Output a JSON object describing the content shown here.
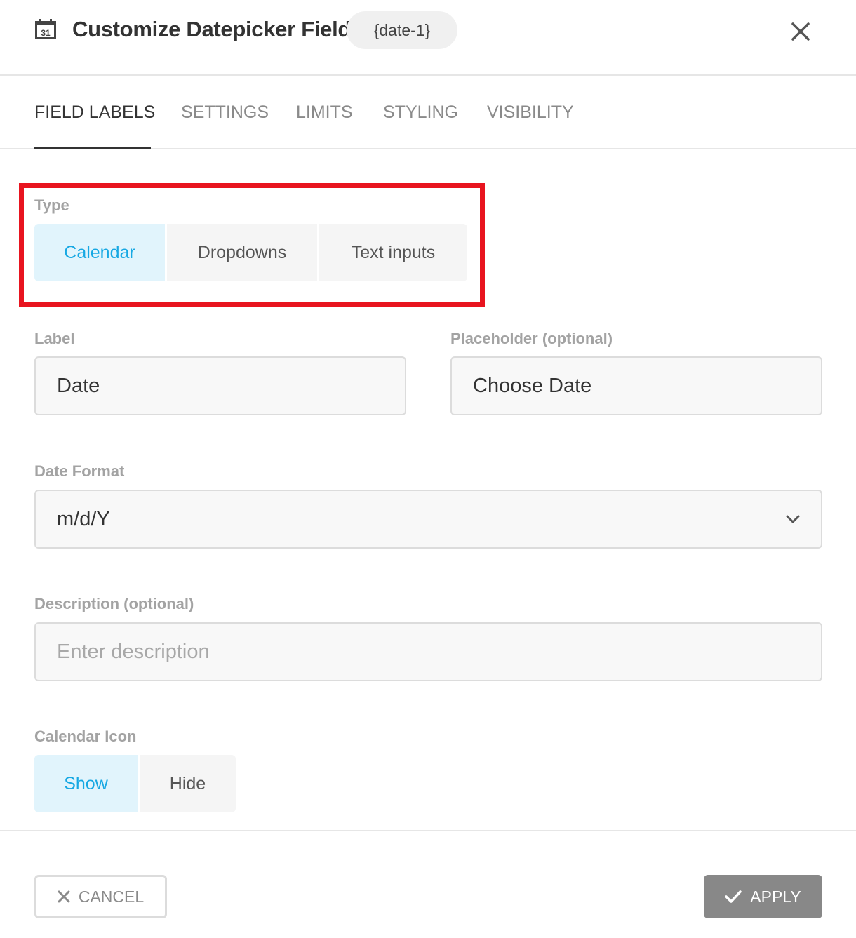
{
  "header": {
    "icon": "calendar-31-icon",
    "icon_day": "31",
    "title": "Customize Datepicker Field",
    "tag": "{date-1}",
    "close_icon": "close-icon"
  },
  "tabs": [
    {
      "label": "FIELD LABELS",
      "active": true
    },
    {
      "label": "SETTINGS",
      "active": false
    },
    {
      "label": "LIMITS",
      "active": false
    },
    {
      "label": "STYLING",
      "active": false
    },
    {
      "label": "VISIBILITY",
      "active": false
    }
  ],
  "type": {
    "label": "Type",
    "options": [
      "Calendar",
      "Dropdowns",
      "Text inputs"
    ],
    "selected": "Calendar"
  },
  "label_field": {
    "label": "Label",
    "value": "Date"
  },
  "placeholder_field": {
    "label": "Placeholder (optional)",
    "value": "Choose Date"
  },
  "date_format": {
    "label": "Date Format",
    "value": "m/d/Y",
    "icon": "chevron-down-icon"
  },
  "description": {
    "label": "Description (optional)",
    "placeholder": "Enter description"
  },
  "calendar_icon": {
    "label": "Calendar Icon",
    "options": [
      "Show",
      "Hide"
    ],
    "selected": "Show"
  },
  "footer": {
    "cancel_label": "CANCEL",
    "apply_label": "APPLY"
  },
  "colors": {
    "accent": "#17a8e3",
    "selected_bg": "#e1f4fc",
    "highlight": "#e8141f",
    "apply_bg": "#888888"
  }
}
